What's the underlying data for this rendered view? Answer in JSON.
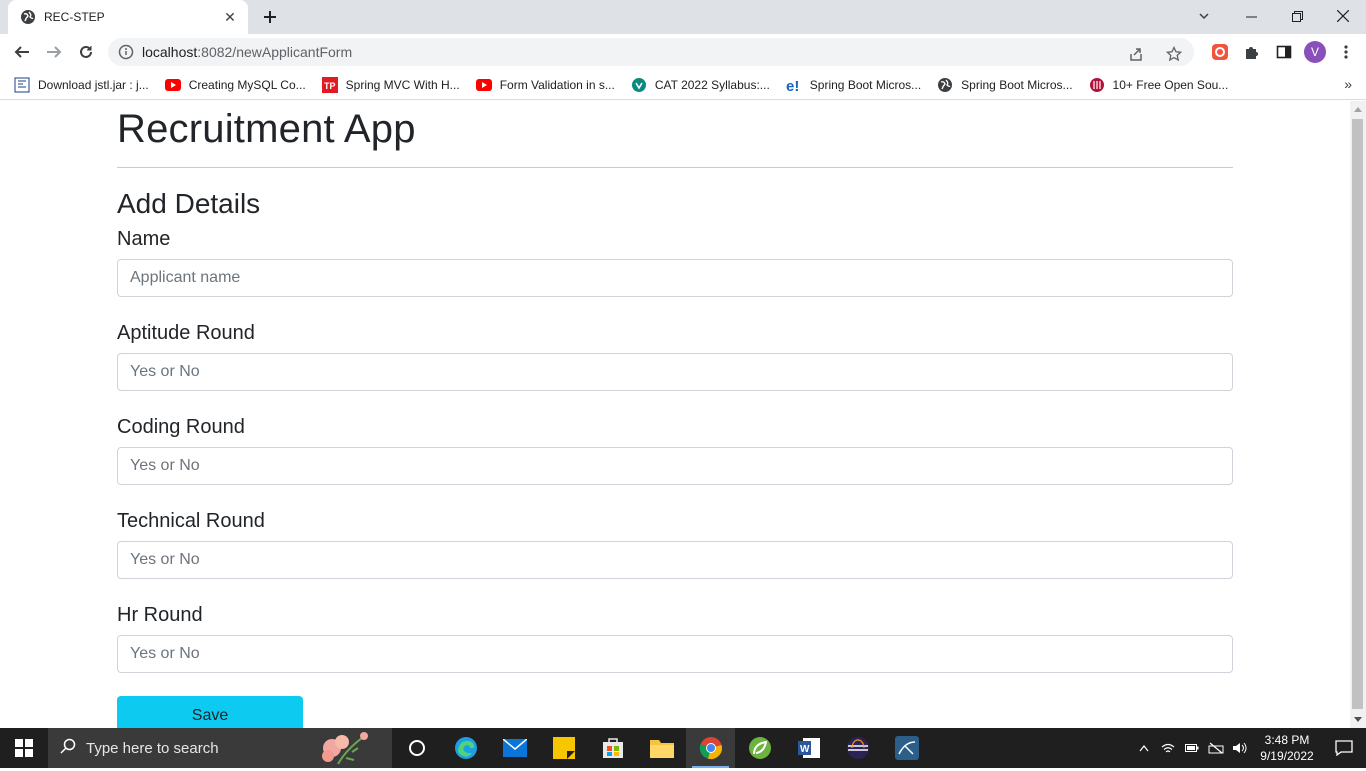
{
  "browser": {
    "tab_title": "REC-STEP",
    "url_host": "localhost",
    "url_rest": ":8082/newApplicantForm",
    "profile_initial": "V"
  },
  "bookmarks": [
    {
      "label": "Download jstl.jar : j...",
      "icon": "doc-icon"
    },
    {
      "label": "Creating MySQL Co...",
      "icon": "youtube-icon"
    },
    {
      "label": "Spring MVC With H...",
      "icon": "tutorialspoint-icon"
    },
    {
      "label": "Form Validation in s...",
      "icon": "youtube-icon"
    },
    {
      "label": "CAT 2022 Syllabus:...",
      "icon": "shield-icon"
    },
    {
      "label": "Spring Boot Micros...",
      "icon": "e-icon"
    },
    {
      "label": "Spring Boot Micros...",
      "icon": "globe-icon"
    },
    {
      "label": "10+ Free Open Sou...",
      "icon": "site-icon"
    }
  ],
  "page": {
    "app_title": "Recruitment App",
    "form_title": "Add Details",
    "fields": [
      {
        "label": "Name",
        "placeholder": "Applicant name",
        "value": ""
      },
      {
        "label": "Aptitude Round",
        "placeholder": "Yes or No",
        "value": ""
      },
      {
        "label": "Coding Round",
        "placeholder": "Yes or No",
        "value": ""
      },
      {
        "label": "Technical Round",
        "placeholder": "Yes or No",
        "value": ""
      },
      {
        "label": "Hr Round",
        "placeholder": "Yes or No",
        "value": ""
      }
    ],
    "save_label": "Save"
  },
  "taskbar": {
    "search_placeholder": "Type here to search",
    "time": "3:48 PM",
    "date": "9/19/2022"
  },
  "colors": {
    "save_button": "#0dcaf0",
    "profile": "#8a4fb8"
  }
}
